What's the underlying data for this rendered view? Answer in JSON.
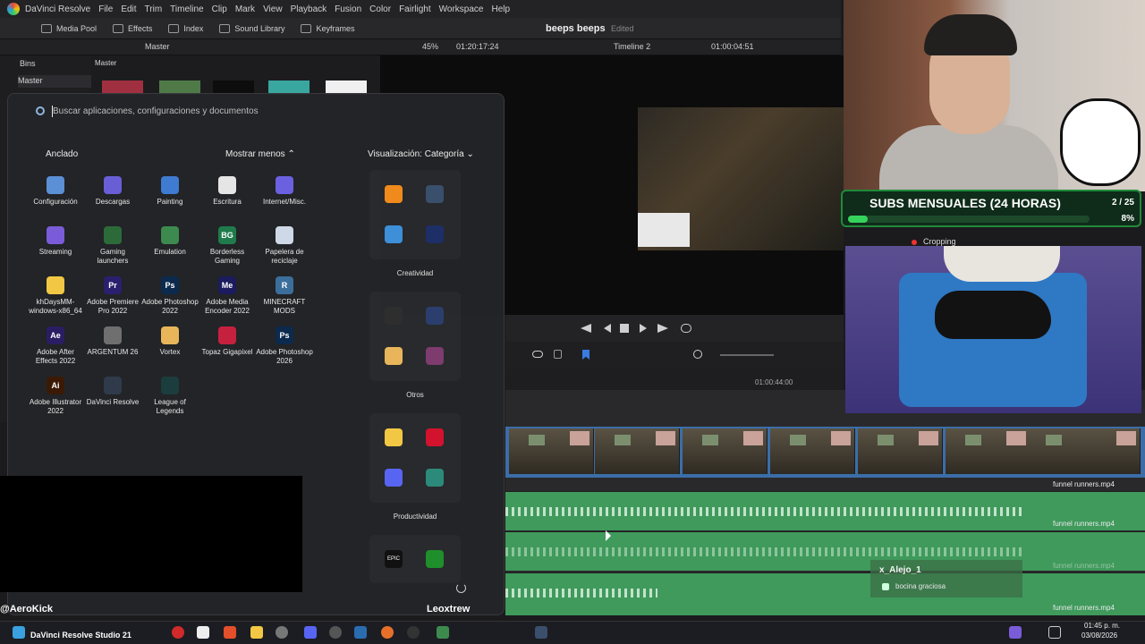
{
  "menubar": {
    "app_name": "DaVinci Resolve",
    "items": [
      "File",
      "Edit",
      "Trim",
      "Timeline",
      "Clip",
      "Mark",
      "View",
      "Playback",
      "Fusion",
      "Color",
      "Fairlight",
      "Workspace",
      "Help"
    ]
  },
  "toolbar": {
    "media_pool": "Media Pool",
    "effects": "Effects",
    "index": "Index",
    "sound_library": "Sound Library",
    "keyframes": "Keyframes",
    "project_name": "beeps beeps",
    "project_status": "Edited"
  },
  "subbar": {
    "bin_name": "Master",
    "zoom": "45%",
    "source_timecode": "01:20:17:24",
    "timeline_name": "Timeline 2",
    "timeline_timecode": "01:00:04:51"
  },
  "bins": {
    "title": "Bins",
    "master": "Master",
    "header_master": "Master"
  },
  "ruler": {
    "timecode": "01:00:44:00"
  },
  "tracks": {
    "video_clip": "funnel runners.mp4",
    "audio1_clip": "funnel runners.mp4",
    "audio2_clip": "funnel runners.mp4",
    "audio3_clip": "funnel runners.mp4"
  },
  "stream": {
    "subs_title": "SUBS MENSUALES (24 HORAS)",
    "subs_count": "2 / 25",
    "subs_percent": "8%",
    "subs_progress": 0.08,
    "cropping_label": "Cropping",
    "channel_name": "@AeroKick",
    "chat_user": "x_Alejo_1",
    "chat_message": "bocina graciosa"
  },
  "start_menu": {
    "search_placeholder": "Buscar aplicaciones, configuraciones y documentos",
    "pinned_title": "Anclado",
    "show_less": "Mostrar menos",
    "view_label": "Visualización: Categoría",
    "apps": [
      {
        "label": "Configuración",
        "icon": "gear-icon",
        "color": "#5b8fd6"
      },
      {
        "label": "Descargas",
        "icon": "folder-group-icon",
        "color": "#6a5ed6"
      },
      {
        "label": "Painting",
        "icon": "paint-group-icon",
        "color": "#3e7bd1"
      },
      {
        "label": "Escritura",
        "icon": "document-group-icon",
        "color": "#e5e5e5"
      },
      {
        "label": "Internet/Misc.",
        "icon": "browser-group-icon",
        "color": "#6b61e0"
      },
      {
        "label": "Streaming",
        "icon": "stream-group-icon",
        "color": "#7a5cd8"
      },
      {
        "label": "Gaming launchers",
        "icon": "launcher-group-icon",
        "color": "#2d6a3a"
      },
      {
        "label": "Emulation",
        "icon": "emulation-group-icon",
        "color": "#3d8a4f"
      },
      {
        "label": "Borderless Gaming",
        "icon": "borderless-gaming-icon",
        "color": "#1f7b4c"
      },
      {
        "label": "Papelera de reciclaje",
        "icon": "recycle-bin-icon",
        "color": "#cfd8e6"
      },
      {
        "label": "khDaysMM-windows-x86_64",
        "icon": "folder-icon",
        "color": "#f2c744"
      },
      {
        "label": "Adobe Premiere Pro 2022",
        "icon": "premiere-icon",
        "color": "#2a1f6e"
      },
      {
        "label": "Adobe Photoshop 2022",
        "icon": "photoshop-icon",
        "color": "#0c2a4d"
      },
      {
        "label": "Adobe Media Encoder 2022",
        "icon": "media-encoder-icon",
        "color": "#1b1b5e"
      },
      {
        "label": "MINECRAFT MODS",
        "icon": "minecraft-group-icon",
        "color": "#3c6e9c"
      },
      {
        "label": "Adobe After Effects 2022",
        "icon": "after-effects-icon",
        "color": "#2b1d63"
      },
      {
        "label": "ARGENTUM 26",
        "icon": "argentum-icon",
        "color": "#6f6f6f"
      },
      {
        "label": "Vortex",
        "icon": "vortex-icon",
        "color": "#e8b55a"
      },
      {
        "label": "Topaz Gigapixel",
        "icon": "topaz-icon",
        "color": "#c6203f"
      },
      {
        "label": "Adobe Photoshop 2026",
        "icon": "photoshop-icon",
        "color": "#0c2a4d"
      },
      {
        "label": "Adobe Illustrator 2022",
        "icon": "illustrator-icon",
        "color": "#3b1a05"
      },
      {
        "label": "DaVinci Resolve",
        "icon": "davinci-icon",
        "color": "#2f3a4a"
      },
      {
        "label": "League of Legends",
        "icon": "league-icon",
        "color": "#1c3d3d"
      }
    ],
    "app_glyphs": [
      "",
      "",
      "",
      "",
      "",
      "",
      "",
      "",
      "BG",
      "",
      "",
      "Pr",
      "Ps",
      "Me",
      "R",
      "Ae",
      "",
      "",
      "",
      "Ps",
      "Ai",
      "",
      ""
    ],
    "categories": [
      "Creatividad",
      "Otros",
      "Productividad"
    ],
    "group_icons": {
      "creatividad": [
        {
          "icon": "vlc-icon",
          "color": "#f08a1c"
        },
        {
          "icon": "davinci-icon",
          "color": "#3a4f6b"
        },
        {
          "icon": "photos-icon",
          "color": "#3d8fd8"
        },
        {
          "icon": "adobe-group-icon",
          "color": "#1d2f66"
        }
      ],
      "otros": [
        {
          "icon": "obs-icon",
          "color": "#2e2e2e"
        },
        {
          "icon": "streamlabs-icon",
          "color": "#2b3e6e"
        },
        {
          "icon": "vortex-icon",
          "color": "#e8b55a"
        },
        {
          "icon": "apps-group-icon",
          "color": "#7d3b6e"
        }
      ],
      "productividad": [
        {
          "icon": "file-explorer-icon",
          "color": "#f2c744"
        },
        {
          "icon": "opera-icon",
          "color": "#d3122e"
        },
        {
          "icon": "discord-icon",
          "color": "#5865f2"
        },
        {
          "icon": "apps-group-icon",
          "color": "#2b8a7a"
        },
        {
          "icon": "epic-games-icon",
          "color": "#111111"
        },
        {
          "icon": "xbox-icon",
          "color": "#1f8f2b"
        }
      ]
    },
    "group_glyphs": {
      "epic": "EPIC"
    },
    "user_name": "Leoxtrew"
  },
  "taskbar": {
    "active_app": "DaVinci Resolve Studio 21",
    "time": "01:45 p. m.",
    "date": "03/08/2026"
  }
}
